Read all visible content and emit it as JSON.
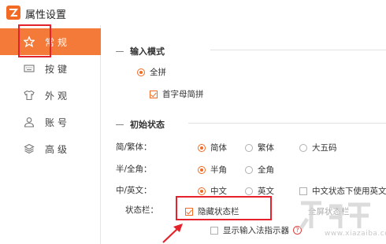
{
  "window": {
    "title": "属性设置"
  },
  "sidebar": {
    "items": [
      {
        "label": "常规",
        "icon": "star-icon",
        "active": true
      },
      {
        "label": "按键",
        "icon": "keyboard-icon",
        "active": false
      },
      {
        "label": "外观",
        "icon": "shirt-icon",
        "active": false
      },
      {
        "label": "账号",
        "icon": "user-icon",
        "active": false
      },
      {
        "label": "高级",
        "icon": "layers-icon",
        "active": false
      }
    ]
  },
  "input_mode": {
    "heading": "输入模式",
    "full_pinyin": "全拼",
    "initial_pinyin": "首字母简拼"
  },
  "initial_state": {
    "heading": "初始状态",
    "script": {
      "label": "简/繁体：",
      "options": [
        "简体",
        "繁体",
        "大五码"
      ],
      "selected": 0
    },
    "width": {
      "label": "半/全角：",
      "options": [
        "半角",
        "全角"
      ],
      "selected": 0
    },
    "language": {
      "label": "中/英文：",
      "options": [
        "中文",
        "英文"
      ],
      "selected": 0,
      "extra_checkbox": "中文状态下使用英文"
    },
    "status_bar": {
      "label": "状态栏：",
      "hide_label": "隐藏状态栏",
      "hide_checked": true,
      "faded_text": "全屏状态栏",
      "indicator_label": "显示输入法指示器",
      "indicator_checked": false
    }
  },
  "colors": {
    "accent": "#f36a24",
    "active_bg": "#f47a3a",
    "highlight": "#e5222b"
  },
  "watermark": {
    "url": "www.xiazaiba.com"
  }
}
